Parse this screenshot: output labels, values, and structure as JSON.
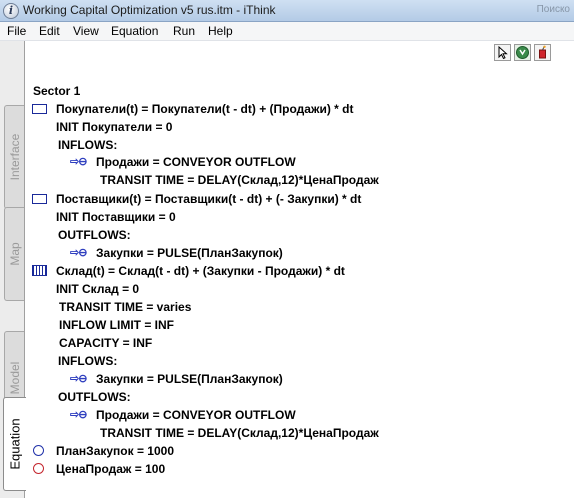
{
  "window": {
    "title": "Working Capital Optimization v5 rus.itm - iThink",
    "bg_window_text": "Поиско"
  },
  "menu": [
    "File",
    "Edit",
    "View",
    "Equation",
    "Run",
    "Help"
  ],
  "tabs": [
    "Interface",
    "Map",
    "Model",
    "Equation"
  ],
  "active_tab": "Equation",
  "toolbar": {
    "pointer": "pointer-arrow-icon",
    "hand": "hand-cursor-icon",
    "dynamite": "dynamite-icon"
  },
  "colors": {
    "stock_blue": "#1a2a9a",
    "flow_blue": "#2f3fbf",
    "converter_red": "#c4262e"
  },
  "equations": {
    "sector": "Sector 1",
    "l1": "Покупатели(t) = Покупатели(t - dt) + (Продажи) * dt",
    "l2": "INIT Покупатели = 0",
    "l3": "INFLOWS:",
    "l4": "Продажи = CONVEYOR OUTFLOW",
    "l5": "TRANSIT TIME = DELAY(Склад,12)*ЦенаПродаж",
    "l6": "Поставщики(t) = Поставщики(t - dt) + (- Закупки) * dt",
    "l7": "INIT Поставщики = 0",
    "l8": "OUTFLOWS:",
    "l9": "Закупки = PULSE(ПланЗакупок)",
    "l10": "Склад(t) = Склад(t - dt) + (Закупки - Продажи) * dt",
    "l11": "INIT Склад = 0",
    "l12": "TRANSIT TIME = varies",
    "l13": "INFLOW LIMIT = INF",
    "l14": "CAPACITY = INF",
    "l15": "INFLOWS:",
    "l16": "Закупки = PULSE(ПланЗакупок)",
    "l17": "OUTFLOWS:",
    "l18": "Продажи = CONVEYOR OUTFLOW",
    "l19": "TRANSIT TIME = DELAY(Склад,12)*ЦенаПродаж",
    "l20": "ПланЗакупок = 1000",
    "l21": "ЦенаПродаж = 100"
  }
}
